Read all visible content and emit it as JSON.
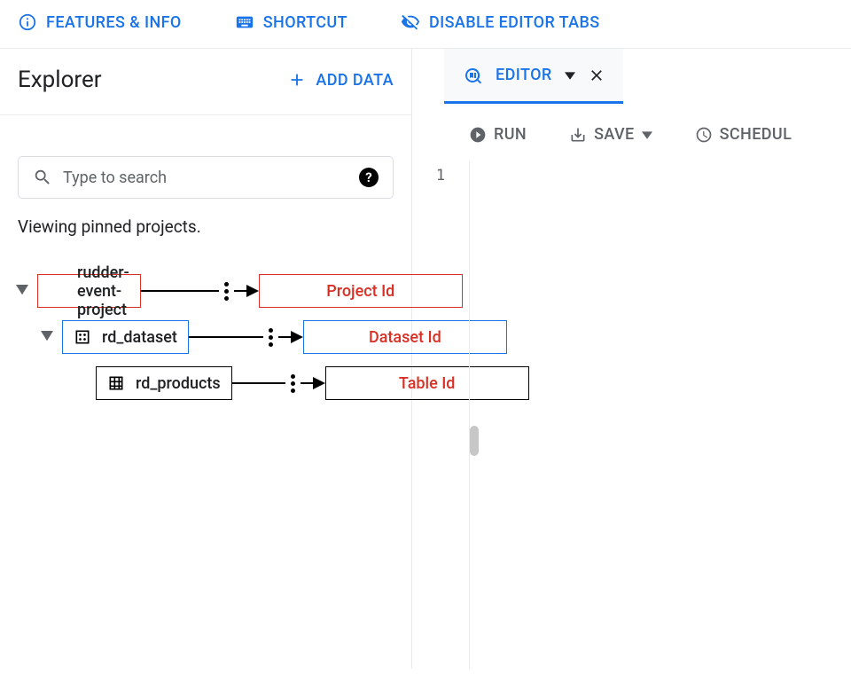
{
  "topbar": {
    "features": "FEATURES & INFO",
    "shortcut": "SHORTCUT",
    "disable": "DISABLE EDITOR TABS"
  },
  "explorer": {
    "title": "Explorer",
    "add_data": "ADD DATA",
    "search_placeholder": "Type to search",
    "viewing": "Viewing pinned projects.",
    "tree": {
      "project": "rudder-event-project",
      "project_label": "Project Id",
      "dataset": "rd_dataset",
      "dataset_label": "Dataset Id",
      "table": "rd_products",
      "table_label": "Table Id"
    }
  },
  "editor": {
    "tab": "EDITOR",
    "run": "RUN",
    "save": "SAVE",
    "schedule": "SCHEDUL",
    "line_no": "1"
  }
}
